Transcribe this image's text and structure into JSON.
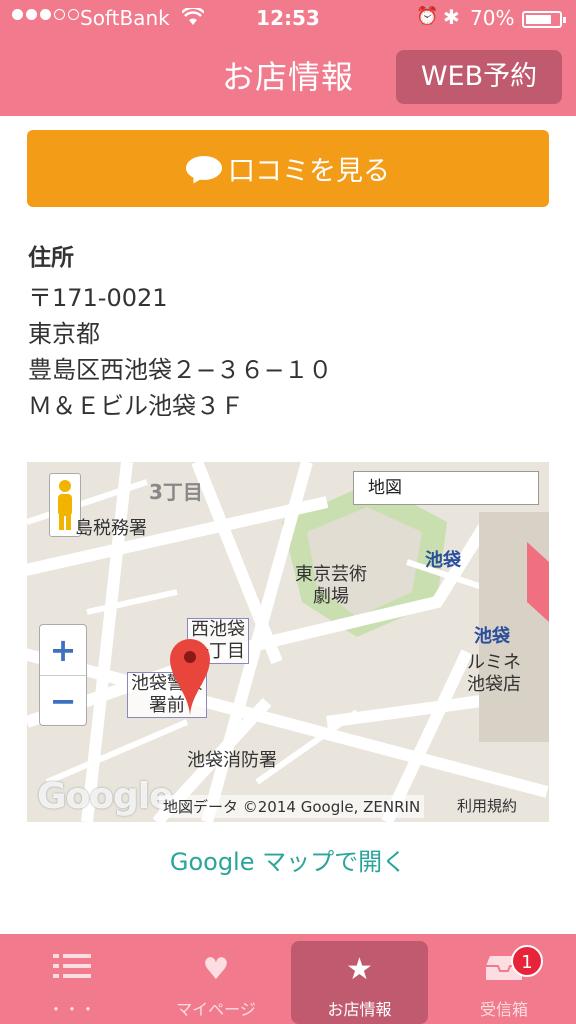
{
  "status_bar": {
    "carrier": "SoftBank",
    "time": "12:53",
    "battery_percent": "70%",
    "battery_level": 0.7
  },
  "header": {
    "title": "お店情報",
    "web_reserve_label": "WEB予約"
  },
  "review_button": {
    "label": "口コミを見る"
  },
  "address": {
    "label": "住所",
    "postal": "〒171-0021",
    "prefecture": "東京都",
    "street": "豊島区西池袋２−３６−１０",
    "building": "Ｍ＆Ｅビル池袋３Ｆ"
  },
  "map": {
    "map_type_label": "地図",
    "zoom_in": "+",
    "zoom_out": "−",
    "labels": {
      "chome3": "3丁目",
      "tax_office": "島税務署",
      "theatre": "東京芸術\n劇場",
      "ikebukuro_metro": "池袋",
      "ikebukuro_jr": "池袋",
      "nishiikebukuro": "西池袋\n一丁目",
      "police": "池袋警察\n署前",
      "lumine": "ルミネ\n池袋店",
      "fire": "池袋消防署"
    },
    "google_logo": "Google",
    "attribution": "地図データ ©2014 Google, ZENRIN",
    "terms": "利用規約"
  },
  "open_in_maps": "Google マップで開く",
  "tabbar": {
    "tabs": [
      {
        "label": "・・・"
      },
      {
        "label": "マイページ"
      },
      {
        "label": "お店情報"
      },
      {
        "label": "受信箱"
      }
    ],
    "inbox_badge": "1"
  },
  "colors": {
    "primary_pink": "#f17a8c",
    "active_tab": "#c05a6e",
    "review_orange": "#f39c18",
    "link_teal": "#29a59a"
  }
}
